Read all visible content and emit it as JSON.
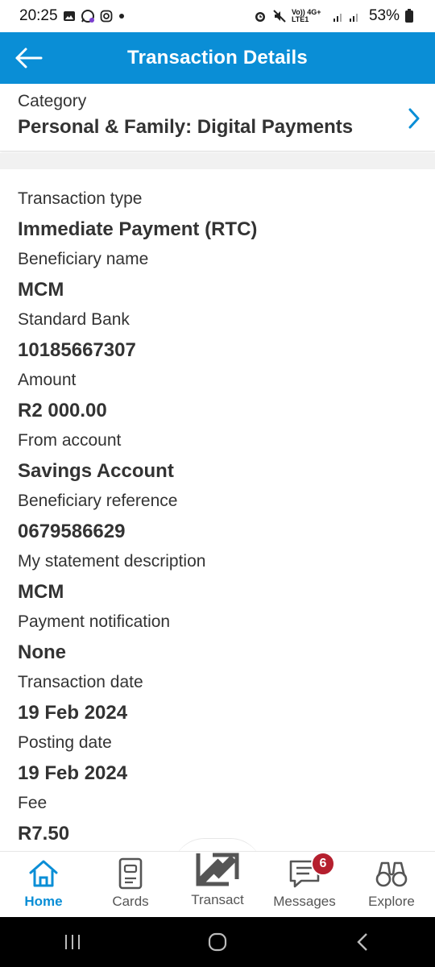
{
  "status_bar": {
    "time": "20:25",
    "network": "Vo)) 4G+ LTE1",
    "battery_percent": "53%",
    "icons": [
      "gallery-icon",
      "whatsapp-icon",
      "instagram-icon",
      "dot-icon",
      "alarm-icon",
      "mute-icon",
      "signal-icon",
      "battery-icon"
    ]
  },
  "header": {
    "title": "Transaction Details",
    "back_icon": "arrow-left-icon",
    "background": "#0a8ed6"
  },
  "category": {
    "label": "Category",
    "value": "Personal & Family: Digital Payments",
    "chevron_icon": "chevron-right-icon"
  },
  "details": [
    {
      "label": "Transaction type",
      "value": "Immediate Payment (RTC)"
    },
    {
      "label": "Beneficiary name",
      "value": "MCM"
    },
    {
      "label": "Standard Bank",
      "value": "10185667307"
    },
    {
      "label": "Amount",
      "value": "R2 000.00"
    },
    {
      "label": "From account",
      "value": "Savings Account"
    },
    {
      "label": "Beneficiary reference",
      "value": "0679586629"
    },
    {
      "label": "My statement description",
      "value": "MCM"
    },
    {
      "label": "Payment notification",
      "value": "None"
    },
    {
      "label": "Transaction date",
      "value": "19 Feb 2024"
    },
    {
      "label": "Posting date",
      "value": "19 Feb 2024"
    },
    {
      "label": "Fee",
      "value": "R7.50"
    }
  ],
  "bottom_nav": {
    "items": [
      {
        "label": "Home",
        "icon": "home-icon",
        "active": true
      },
      {
        "label": "Cards",
        "icon": "card-icon",
        "active": false
      },
      {
        "label": "Transact",
        "icon": "transact-arrows-icon",
        "active": false
      },
      {
        "label": "Messages",
        "icon": "message-icon",
        "active": false,
        "badge": "6"
      },
      {
        "label": "Explore",
        "icon": "binoculars-icon",
        "active": false
      }
    ],
    "active_color": "#0a8ed6",
    "badge_color": "#b51f2e"
  },
  "system_nav": {
    "icons": [
      "recent-apps-icon",
      "home-circle-icon",
      "back-chevron-icon"
    ]
  }
}
